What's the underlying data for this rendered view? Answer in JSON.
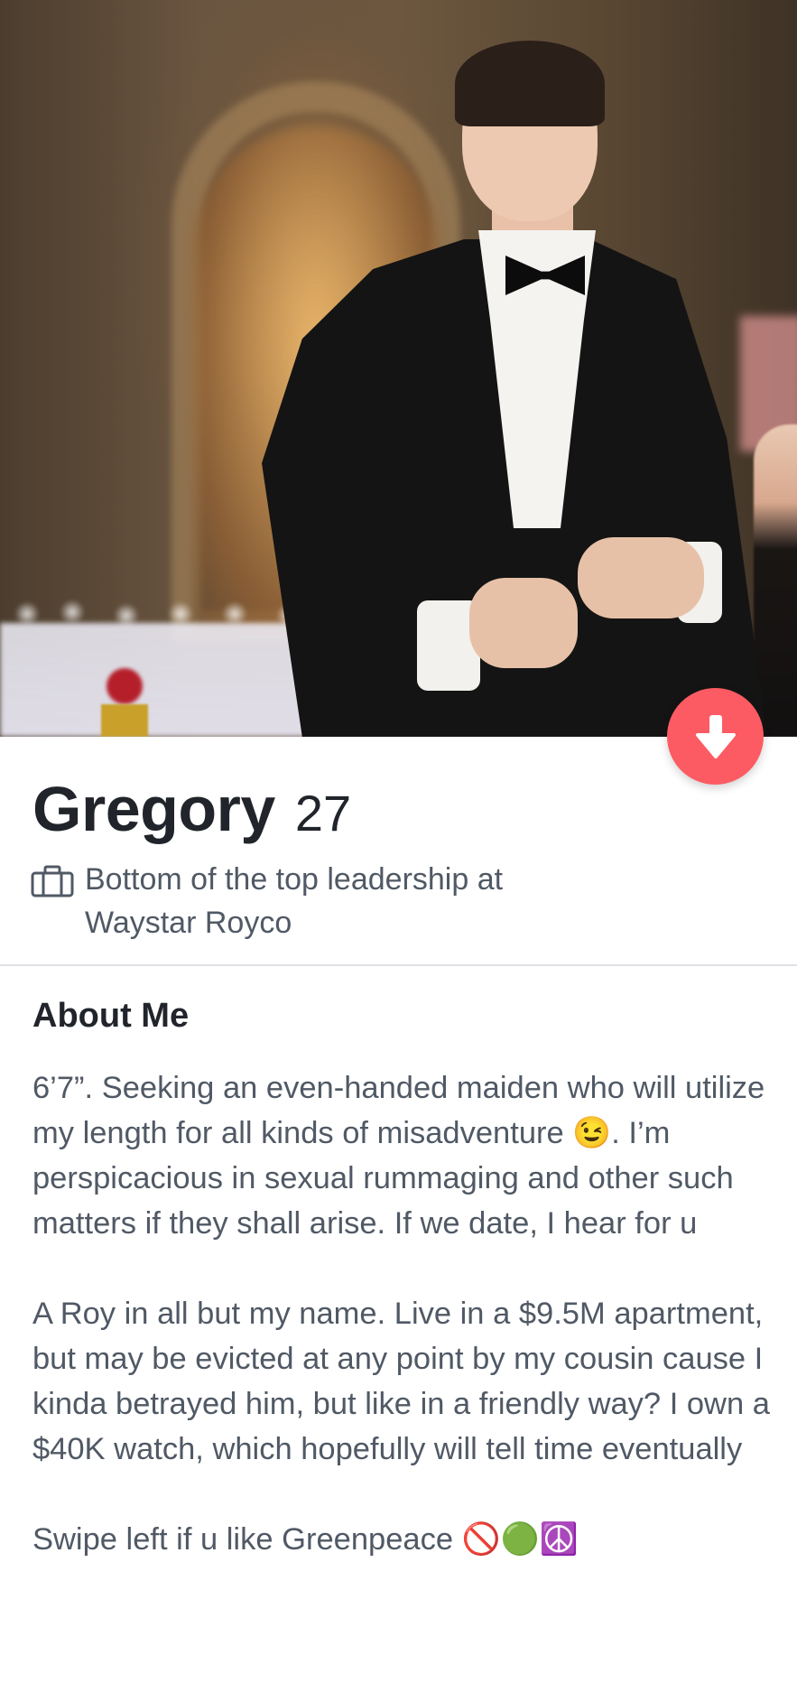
{
  "profile": {
    "name": "Gregory",
    "age": "27",
    "job_line_1": "Bottom of the top leadership at",
    "job_line_2": "Waystar Royco",
    "job_icon": "briefcase-icon"
  },
  "actions": {
    "collapse_icon": "arrow-down-icon",
    "accent_color": "#fd5b63"
  },
  "about": {
    "title": "About Me",
    "paragraph_1": "6’7”. Seeking an even-handed maiden who will utilize my length for all kinds of misadventure 😉. I’m perspicacious in sexual rummaging and other such matters if they shall arise. If we date, I hear for u",
    "paragraph_2": "A Roy in all but my name. Live in a $9.5M apartment, but may be evicted at any point by my cousin cause I kinda betrayed him, but like in a friendly way? I own a $40K watch, which hopefully will tell time eventually",
    "paragraph_3": "Swipe left if u like Greenpeace 🚫🟢☮️"
  },
  "colors": {
    "text_dark": "#21252b",
    "text_body": "#505965",
    "divider": "#dfe1e6"
  }
}
